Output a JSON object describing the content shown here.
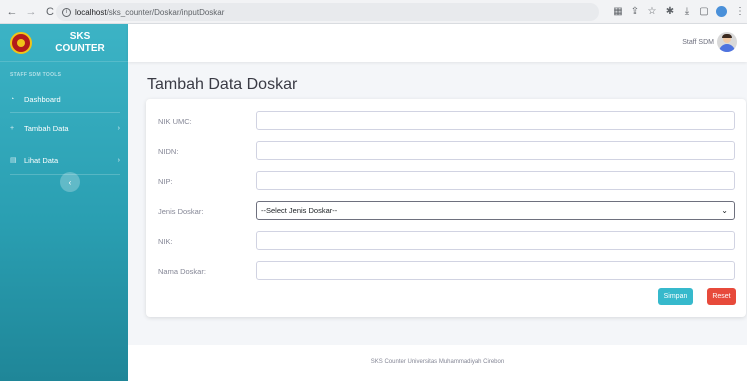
{
  "browser": {
    "url_host": "localhost",
    "url_path": "/sks_counter/Doskar/inputDoskar"
  },
  "sidebar": {
    "brand_line1": "SKS",
    "brand_line2": "COUNTER",
    "section_title": "STAFF SDM TOOLS",
    "items": [
      {
        "label": "Dashboard",
        "icon": "dashboard-icon"
      },
      {
        "label": "Tambah Data",
        "icon": "plus-icon"
      },
      {
        "label": "Lihat Data",
        "icon": "file-icon"
      }
    ]
  },
  "topbar": {
    "user_name": "Staff SDM"
  },
  "page": {
    "title": "Tambah Data Doskar"
  },
  "form": {
    "fields": [
      {
        "label": "NIK UMC:",
        "value": ""
      },
      {
        "label": "NIDN:",
        "value": ""
      },
      {
        "label": "NIP:",
        "value": ""
      },
      {
        "label": "Jenis Doskar:",
        "value": "--Select Jenis Doskar--"
      },
      {
        "label": "NIK:",
        "value": ""
      },
      {
        "label": "Nama Doskar:",
        "value": ""
      }
    ],
    "save_label": "Simpan",
    "reset_label": "Reset"
  },
  "footer": {
    "text": "SKS Counter Universitas Muhammadiyah Cirebon"
  },
  "colors": {
    "sidebar_top": "#3cb3c5",
    "sidebar_bottom": "#1f8698",
    "save_button": "#36b9cc",
    "reset_button": "#e74a3b"
  }
}
